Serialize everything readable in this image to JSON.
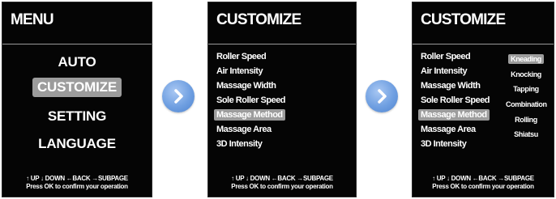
{
  "screens": [
    {
      "title": "MENU",
      "items": [
        "AUTO",
        "CUSTOMIZE",
        "SETTING",
        "LANGUAGE"
      ],
      "selected_index": 1,
      "footer": [
        "↑ UP ↓ DOWN ←BACK →SUBPAGE",
        "Press OK to confirm your operation"
      ]
    },
    {
      "title": "CUSTOMIZE",
      "items": [
        "Roller Speed",
        "Air Intensity",
        "Massage Width",
        "Sole Roller Speed",
        "Massage Method",
        "Massage Area",
        "3D Intensity"
      ],
      "selected_index": 4,
      "footer": [
        "↑ UP ↓ DOWN ←BACK →SUBPAGE",
        "Press OK to confirm your operation"
      ]
    },
    {
      "title": "CUSTOMIZE",
      "items": [
        "Roller Speed",
        "Air Intensity",
        "Massage Width",
        "Sole Roller Speed",
        "Massage Method",
        "Massage Area",
        "3D Intensity"
      ],
      "selected_index": 4,
      "subpage": {
        "items": [
          "Kneading",
          "Knocking",
          "Tapping",
          "Combination",
          "Rolling",
          "Shiatsu"
        ],
        "selected_index": 0
      },
      "footer": [
        "↑ UP ↓ DOWN ←BACK →SUBPAGE",
        "Press OK to confirm your operation"
      ]
    }
  ],
  "arrows": [
    {
      "icon": "chevron-right-icon"
    },
    {
      "icon": "chevron-right-icon"
    }
  ],
  "colors": {
    "screen_bg": "#050505",
    "highlight": "#9c9c9c",
    "arrow_blue": "#6f9fe1"
  }
}
